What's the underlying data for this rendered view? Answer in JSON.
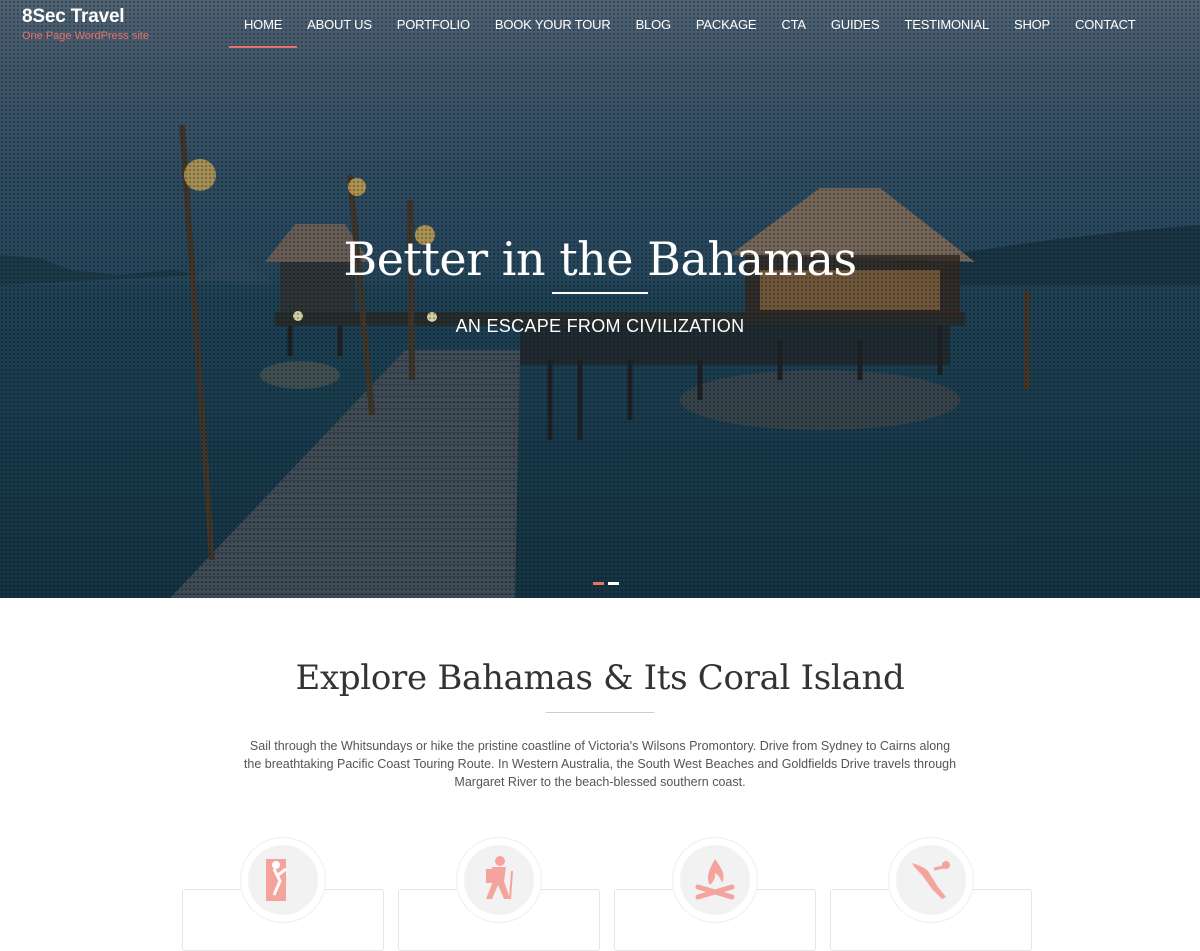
{
  "brand": {
    "title": "8Sec Travel",
    "tagline": "One Page WordPress site"
  },
  "nav": [
    "HOME",
    "ABOUT US",
    "PORTFOLIO",
    "BOOK YOUR TOUR",
    "BLOG",
    "PACKAGE",
    "CTA",
    "GUIDES",
    "TESTIMONIAL",
    "SHOP",
    "CONTACT"
  ],
  "nav_active": "HOME",
  "hero": {
    "title": "Better in the Bahamas",
    "subtitle": "AN ESCAPE FROM CIVILIZATION",
    "slides": 2,
    "active_slide": 1
  },
  "section": {
    "heading": "Explore Bahamas & Its Coral Island",
    "text": "Sail through the Whitsundays or hike the pristine coastline of Victoria's Wilsons Promontory. Drive from Sydney to Cairns along the breathtaking Pacific Coast Touring Route. In Western Australia, the South West Beaches and Goldfields Drive travels through Margaret River to the beach-blessed southern coast."
  },
  "features": [
    {
      "icon": "climbing-icon"
    },
    {
      "icon": "hiking-icon"
    },
    {
      "icon": "campfire-icon"
    },
    {
      "icon": "diving-icon"
    }
  ],
  "colors": {
    "accent": "#e8736b",
    "icon": "#f4a49c"
  }
}
